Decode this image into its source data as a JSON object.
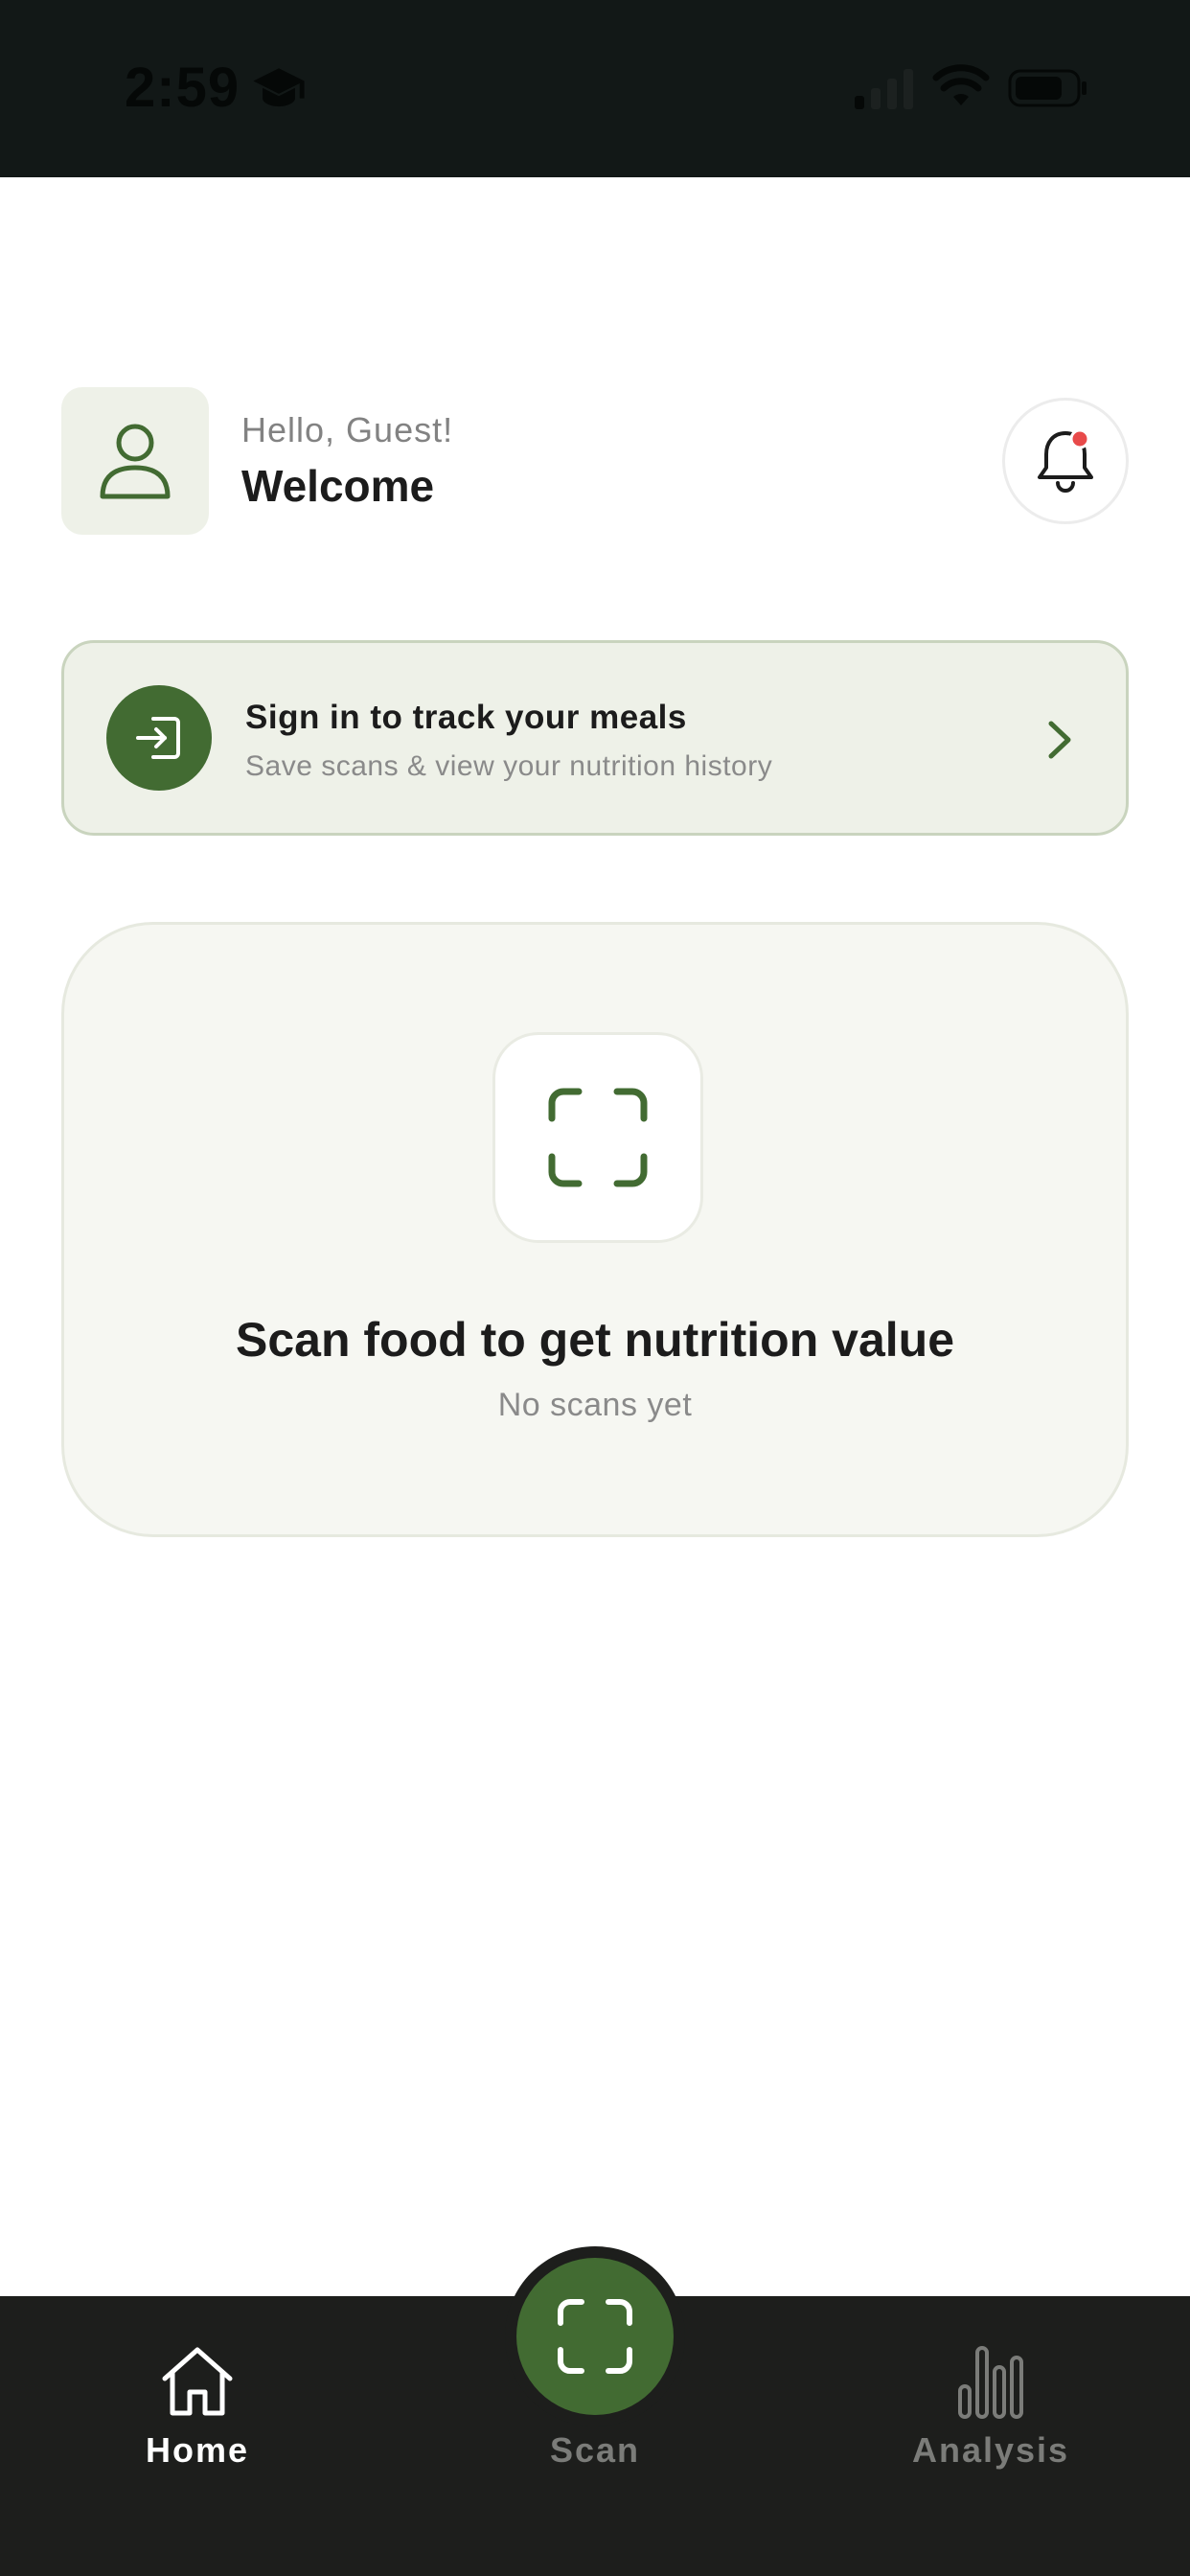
{
  "status_bar": {
    "time": "2:59",
    "icons": [
      "graduation-cap-icon",
      "cellular-signal-icon",
      "wifi-icon",
      "battery-icon"
    ]
  },
  "header": {
    "greeting": "Hello, Guest!",
    "welcome": "Welcome",
    "avatar_icon": "user-icon",
    "notification_icon": "bell-icon",
    "notification_badge_color": "#e84a4a"
  },
  "signin_card": {
    "title": "Sign in to track your meals",
    "subtitle": "Save scans & view your nutrition history",
    "icon": "sign-in-icon",
    "action_icon": "chevron-right-icon"
  },
  "scan_card": {
    "title": "Scan food to get nutrition value",
    "subtitle": "No scans yet",
    "icon": "scan-frame-icon"
  },
  "bottom_nav": {
    "items": [
      {
        "label": "Home",
        "icon": "home-icon",
        "active": true
      },
      {
        "label": "Scan",
        "icon": "scan-frame-icon",
        "active": false
      },
      {
        "label": "Analysis",
        "icon": "bar-chart-icon",
        "active": false
      }
    ]
  },
  "colors": {
    "accent": "#426b32",
    "card_tint": "#eef1e8",
    "nav_background": "#1d1e1c",
    "status_bar_background": "#121817"
  }
}
